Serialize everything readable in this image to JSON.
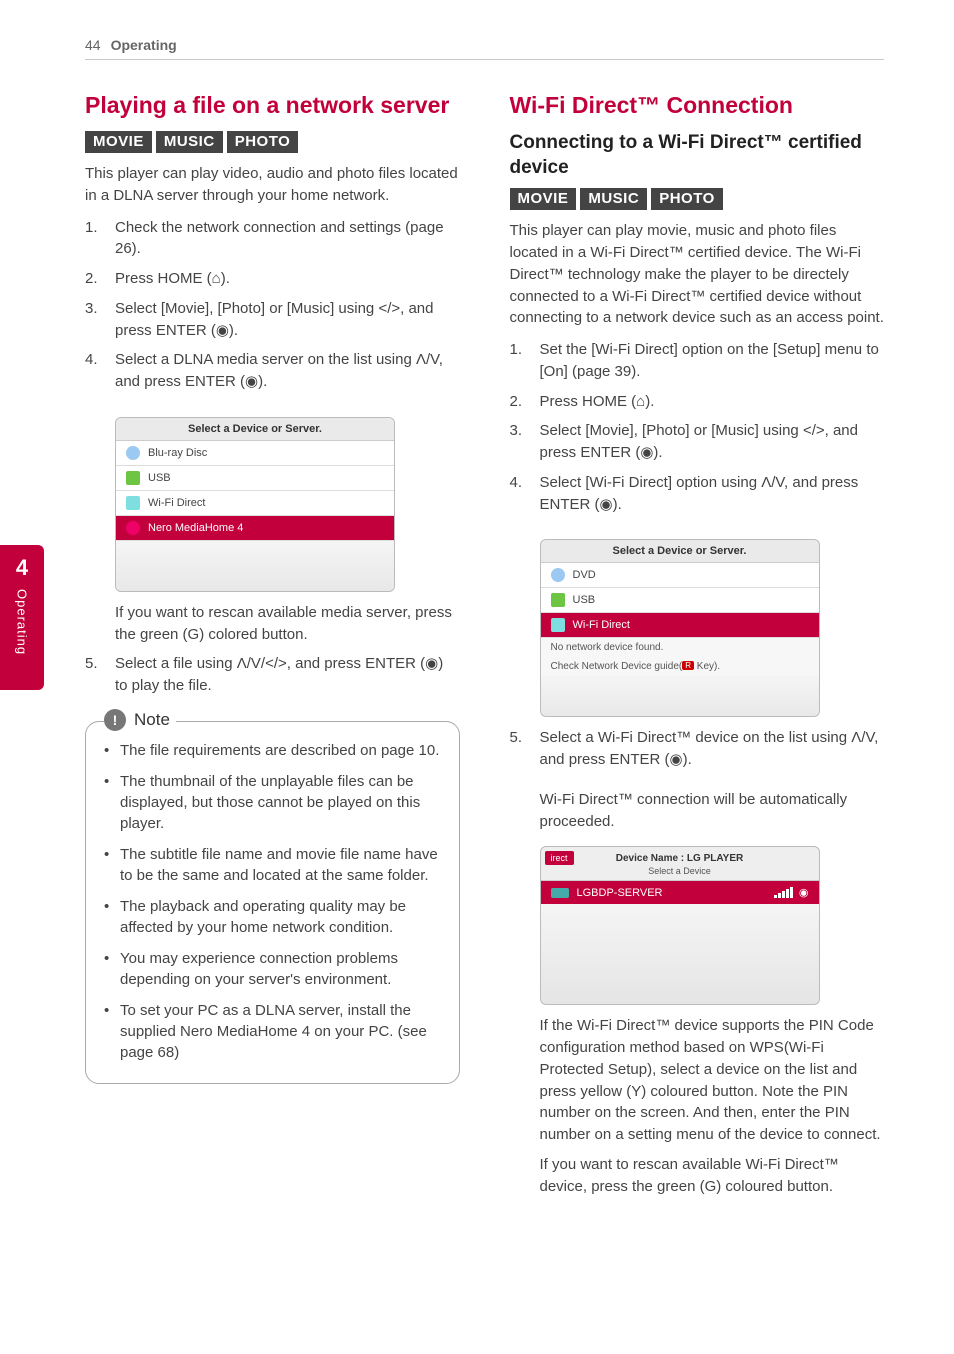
{
  "page": {
    "number": "44",
    "section": "Operating"
  },
  "sidebar": {
    "number": "4",
    "label": "Operating"
  },
  "badges": {
    "movie": "MOVIE",
    "music": "MUSIC",
    "photo": "PHOTO"
  },
  "left": {
    "title": "Playing a file on a network server",
    "intro": "This player can play video, audio and photo files located in a DLNA server through your home network.",
    "steps": [
      "Check the network connection and settings (page 26).",
      "Press HOME (⌂).",
      "Select [Movie], [Photo] or [Music] using </>, and press ENTER (◉).",
      "Select a DLNA media server on the list using Λ/V, and press ENTER (◉)."
    ],
    "shot1": {
      "title": "Select a Device or Server.",
      "rows": [
        "Blu-ray Disc",
        "USB",
        "Wi-Fi Direct",
        "Nero MediaHome 4"
      ]
    },
    "afterShot1": "If you want to rescan available media server, press the green (G) colored button.",
    "step5": "Select a file using Λ/V/</>, and press ENTER (◉) to play the file.",
    "note": {
      "label": "Note",
      "items": [
        "The file requirements are described on page 10.",
        "The thumbnail of the unplayable files can be displayed, but those cannot be played on this player.",
        "The subtitle file name and movie file name have to be the same and located at the same folder.",
        "The playback and operating quality may be affected by your home network condition.",
        "You may experience connection problems depending on your server's environment.",
        "To set your PC as a DLNA server, install the supplied Nero MediaHome 4 on your PC. (see page 68)"
      ]
    }
  },
  "right": {
    "title": "Wi-Fi Direct™ Connection",
    "subtitle": "Connecting to a Wi-Fi Direct™ certified device",
    "intro": "This player can play movie, music and photo files located in a Wi-Fi Direct™ certified device. The Wi-Fi Direct™ technology make the player to be directely connected to a Wi-Fi Direct™ certified device without connecting to a network device such as an access point.",
    "steps": [
      "Set the [Wi-Fi Direct] option on the [Setup] menu to [On] (page 39).",
      "Press HOME (⌂).",
      "Select [Movie], [Photo] or [Music] using </>, and press ENTER (◉).",
      "Select [Wi-Fi Direct] option using Λ/V, and press ENTER (◉)."
    ],
    "shot1": {
      "title": "Select a Device or Server.",
      "rows": [
        "DVD",
        "USB",
        "Wi-Fi Direct"
      ],
      "msg1": "No network device found.",
      "msg2a": "Check Network Device guide(",
      "msg2b": " Key).",
      "redkey": "R"
    },
    "step5": "Select a Wi-Fi Direct™ device on the list using Λ/V, and press ENTER (◉).",
    "step5b": "Wi-Fi Direct™ connection will be automatically proceeded.",
    "shot2": {
      "tab": "irect",
      "head": "Device Name : LG PLAYER",
      "sub": "Select a Device",
      "row": "LGBDP-SERVER"
    },
    "after2a": "If the Wi-Fi Direct™ device supports the PIN Code configuration method based on WPS(Wi-Fi Protected Setup), select a device on the list and press yellow (Y) coloured button. Note the PIN number on the screen. And then, enter the PIN number on a setting menu of the device to connect.",
    "after2b": "If you want to rescan available Wi-Fi Direct™ device, press the green (G) coloured button."
  }
}
